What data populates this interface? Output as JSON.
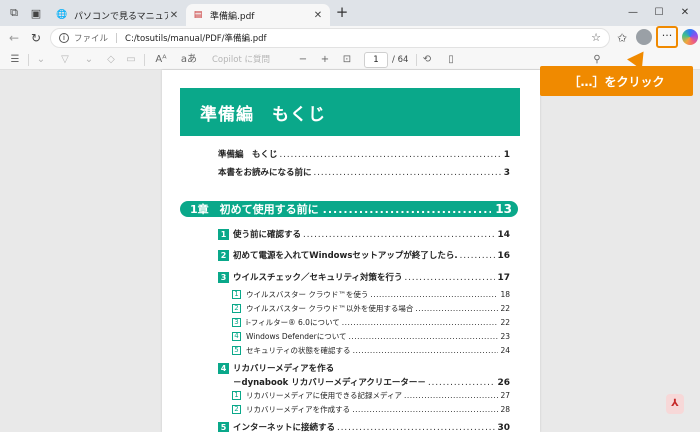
{
  "browser": {
    "tabs": [
      {
        "title": "パソコンで見るマニュアル",
        "icon": "globe-icon",
        "active": false
      },
      {
        "title": "準備編.pdf",
        "icon": "pdf-icon",
        "active": true
      }
    ],
    "address": {
      "scheme": "ファイル",
      "url": "C:/tosutils/manual/PDF/準備編.pdf"
    }
  },
  "pdf_toolbar": {
    "copilot_label": "Copilot に質問",
    "current_page": "1",
    "total_pages": "/ 64",
    "read_aloud": "aあ",
    "text_size": "Aᴬ"
  },
  "callout": {
    "text": "［…］をクリック"
  },
  "document": {
    "header_title": "準備編　もくじ",
    "toc_front": [
      {
        "title": "準備編　もくじ",
        "page": "1"
      },
      {
        "title": "本書をお読みになる前に",
        "page": "3"
      }
    ],
    "chapter": {
      "title": "1章　初めて使用する前に",
      "page": "13"
    },
    "sections": [
      {
        "num": "1",
        "title": "使う前に確認する",
        "page": "14"
      },
      {
        "num": "2",
        "title": "初めて電源を入れてWindowsセットアップが終了したら.",
        "page": "16"
      },
      {
        "num": "3",
        "title": "ウイルスチェック／セキュリティ対策を行う",
        "page": "17"
      },
      {
        "num": "4",
        "title": "リカバリーメディアを作る",
        "title2": "－dynabook リカバリーメディアクリエーター－",
        "page": "26"
      },
      {
        "num": "5",
        "title": "インターネットに接続する",
        "page": "30"
      }
    ],
    "subsections_3": [
      {
        "num": "1",
        "title": "ウイルスバスター クラウド™を使う",
        "page": "18"
      },
      {
        "num": "2",
        "title": "ウイルスバスター クラウド™以外を使用する場合",
        "page": "22"
      },
      {
        "num": "3",
        "title": "i-フィルター® 6.0について",
        "page": "22"
      },
      {
        "num": "4",
        "title": "Windows Defenderについて",
        "page": "23"
      },
      {
        "num": "5",
        "title": "セキュリティの状態を確認する",
        "page": "24"
      }
    ],
    "subsections_4": [
      {
        "num": "1",
        "title": "リカバリーメディアに使用できる記録メディア",
        "page": "27"
      },
      {
        "num": "2",
        "title": "リカバリーメディアを作成する",
        "page": "28"
      }
    ]
  },
  "colors": {
    "accent_green": "#0aa88a",
    "callout_orange": "#f08a00"
  }
}
